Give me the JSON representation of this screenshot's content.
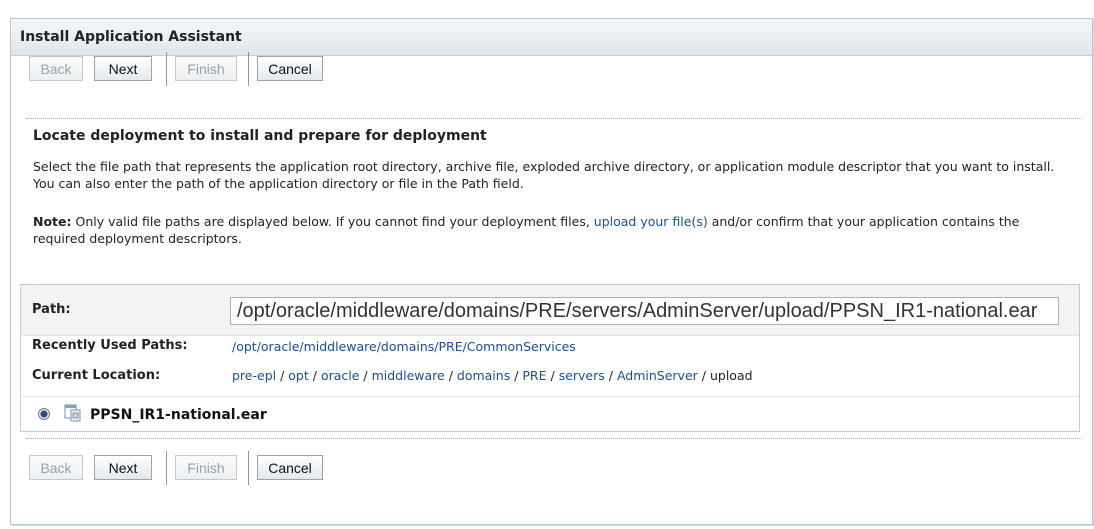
{
  "window": {
    "title": "Install Application Assistant"
  },
  "toolbar": {
    "back_label": "Back",
    "next_label": "Next",
    "finish_label": "Finish",
    "cancel_label": "Cancel"
  },
  "content": {
    "heading": "Locate deployment to install and prepare for deployment",
    "description": "Select the file path that represents the application root directory, archive file, exploded archive directory, or application module descriptor that you want to install. You can also enter the path of the application directory or file in the Path field.",
    "note_label": "Note:",
    "note_text_1": " Only valid file paths are displayed below. If you cannot find your deployment files, ",
    "note_link": "upload your file(s)",
    "note_text_2": " and/or confirm that your application contains the required deployment descriptors."
  },
  "path": {
    "label": "Path:",
    "value": "/opt/oracle/middleware/domains/PRE/servers/AdminServer/upload/PPSN_IR1-national.ear",
    "recent_label": "Recently Used Paths:",
    "recent_value": "/opt/oracle/middleware/domains/PRE/CommonServices",
    "location_label": "Current Location:",
    "crumbs": [
      "pre-epl",
      "opt",
      "oracle",
      "middleware",
      "domains",
      "PRE",
      "servers",
      "AdminServer",
      "upload"
    ]
  },
  "file": {
    "name": "PPSN_IR1-national.ear",
    "selected": true
  }
}
